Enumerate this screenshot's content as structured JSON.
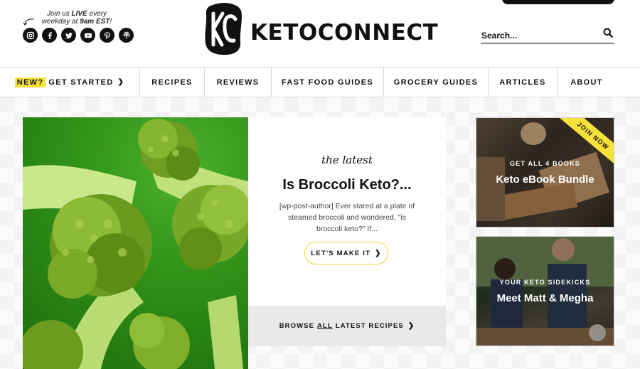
{
  "header": {
    "join_text_1": "Join us",
    "join_live": "LIVE",
    "join_text_2": "every",
    "join_line2_a": "weekday at",
    "join_time": "9am EST",
    "join_line2_b": "!",
    "socials": [
      "instagram-icon",
      "facebook-icon",
      "twitter-icon",
      "youtube-icon",
      "pinterest-icon",
      "podcast-icon"
    ],
    "logo_text": "KETOCONNECT",
    "search_label": "Search..."
  },
  "nav": {
    "new_badge": "NEW?",
    "items": [
      "GET STARTED",
      "RECIPES",
      "REVIEWS",
      "FAST FOOD GUIDES",
      "GROCERY GUIDES",
      "ARTICLES",
      "ABOUT"
    ]
  },
  "feature": {
    "kicker": "the latest",
    "title": "Is Broccoli Keto?...",
    "excerpt": "[wp-post-author] Ever stared at a plate of steamed broccoli and wondered, \"is broccoli keto?\" If...",
    "button": "LET'S MAKE IT",
    "browse_a": "BROWSE",
    "browse_all": "ALL",
    "browse_b": "LATEST RECIPES"
  },
  "side": {
    "card1": {
      "ribbon": "JOIN NOW",
      "kicker": "GET ALL 4 BOOKS",
      "title": "Keto eBook Bundle"
    },
    "card2": {
      "kicker": "YOUR KETO SIDEKICKS",
      "title": "Meet Matt & Megha"
    }
  },
  "colors": {
    "accent": "#f7e13b",
    "button_border": "#f3d33a",
    "text": "#111111"
  }
}
